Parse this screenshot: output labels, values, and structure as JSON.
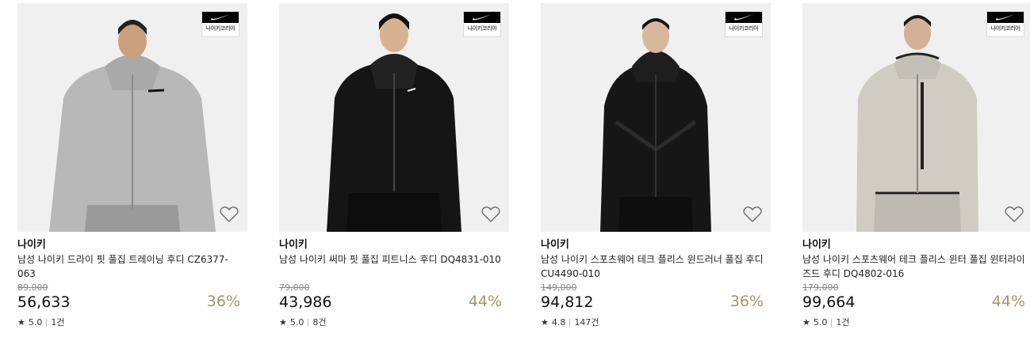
{
  "brand_badge_label": "나이키코리아",
  "wishlist_icon": "heart-outline-icon",
  "star_icon": "★",
  "colors": {
    "discount": "#a8946a",
    "image_bg": "#f0f0f0"
  },
  "products": [
    {
      "brand": "나이키",
      "name": "남성 나이키 드라이 핏 풀집 트레이닝 후디 CZ6377-063",
      "original_price": "89,000",
      "sale_price": "56,633",
      "discount": "36%",
      "rating": "5.0",
      "reviews": "1건"
    },
    {
      "brand": "나이키",
      "name": "남성 나이키 써마 핏 풀집 피트니스 후디 DQ4831-010",
      "original_price": "79,000",
      "sale_price": "43,986",
      "discount": "44%",
      "rating": "5.0",
      "reviews": "8건"
    },
    {
      "brand": "나이키",
      "name": "남성 나이키 스포츠웨어 테크 플리스 윈드러너 풀집 후디 CU4490-010",
      "original_price": "149,000",
      "sale_price": "94,812",
      "discount": "36%",
      "rating": "4.8",
      "reviews": "147건"
    },
    {
      "brand": "나이키",
      "name": "남성 나이키 스포츠웨어 테크 플리스 윈터 풀집 윈터라이즈드 후디 DQ4802-016",
      "original_price": "179,000",
      "sale_price": "99,664",
      "discount": "44%",
      "rating": "5.0",
      "reviews": "1건"
    }
  ]
}
